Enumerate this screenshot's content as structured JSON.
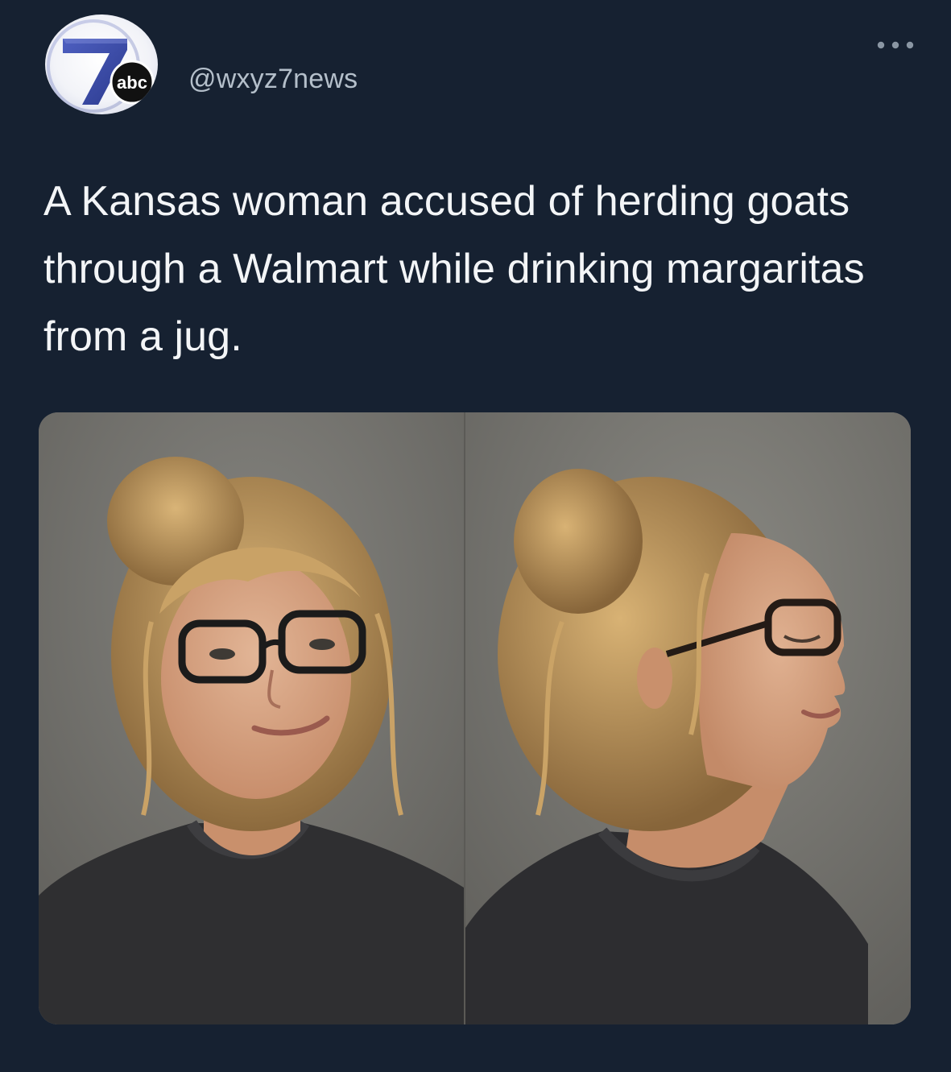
{
  "tweet": {
    "author_handle": "@wxyz7news",
    "avatar": {
      "logo_number": "7",
      "logo_network": "abc",
      "brand_color": "#3a4ba6"
    },
    "more_icon": "more-horizontal-icon",
    "text": "A Kansas woman accused of herding goats through a Walmart while drinking margaritas from a jug."
  },
  "media": {
    "photos": [
      {
        "view": "front"
      },
      {
        "view": "profile"
      }
    ]
  },
  "colors": {
    "background": "#162131",
    "text_primary": "#f3f5f7",
    "text_secondary": "#b4bfca"
  }
}
